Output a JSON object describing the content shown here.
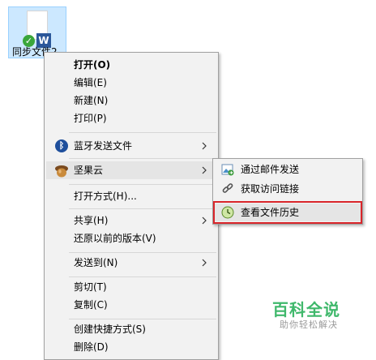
{
  "desktop_file": {
    "name": "同步文件2",
    "icon": "word-document-icon",
    "sync_status_icon": "green-check-icon"
  },
  "context_menu": {
    "items": [
      {
        "label": "打开(O)",
        "bold": true
      },
      {
        "label": "编辑(E)"
      },
      {
        "label": "新建(N)"
      },
      {
        "label": "打印(P)"
      },
      {
        "label": "蓝牙发送文件",
        "icon": "bluetooth-icon",
        "submenu": true
      },
      {
        "label": "坚果云",
        "icon": "nutstore-icon",
        "submenu": true,
        "highlighted": true
      },
      {
        "label": "打开方式(H)..."
      },
      {
        "label": "共享(H)",
        "submenu": true
      },
      {
        "label": "还原以前的版本(V)"
      },
      {
        "label": "发送到(N)",
        "submenu": true
      },
      {
        "label": "剪切(T)"
      },
      {
        "label": "复制(C)"
      },
      {
        "label": "创建快捷方式(S)"
      },
      {
        "label": "删除(D)"
      }
    ]
  },
  "submenu": {
    "items": [
      {
        "label": "通过邮件发送",
        "icon": "mail-icon"
      },
      {
        "label": "获取访问链接",
        "icon": "link-icon"
      },
      {
        "label": "查看文件历史",
        "icon": "history-clock-icon",
        "selected": true
      }
    ],
    "annotation_color": "#d9252a"
  },
  "watermark": {
    "main": "百科全说",
    "sub": "助你轻松解决"
  }
}
